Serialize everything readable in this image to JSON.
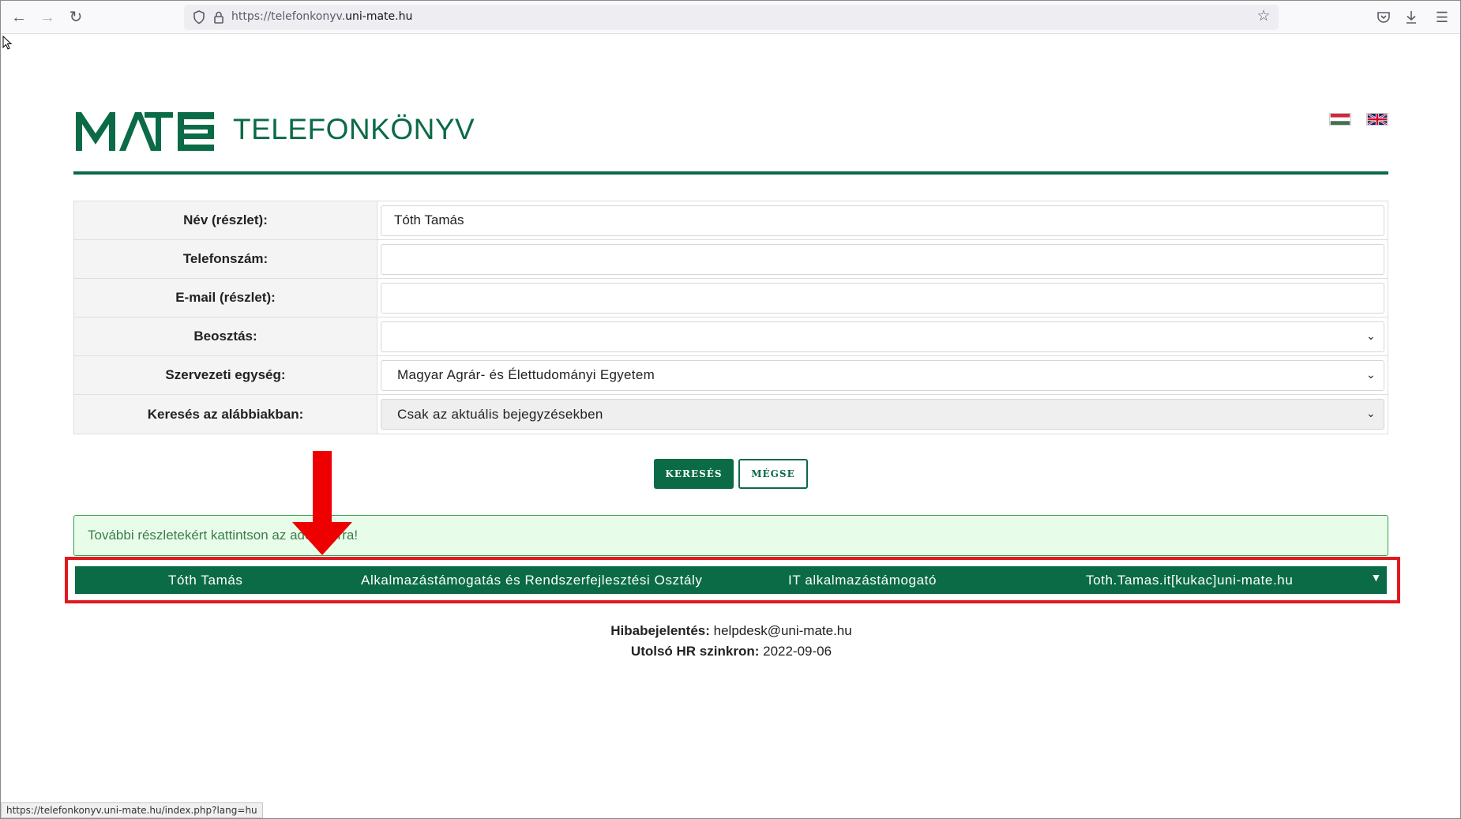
{
  "browser": {
    "url_prefix": "https://telefonkonyv.",
    "url_domain": "uni-mate.hu",
    "status_url": "https://telefonkonyv.uni-mate.hu/index.php?lang=hu"
  },
  "header": {
    "logo_text": "MATE",
    "title": "TELEFONKÖNYV"
  },
  "form": {
    "name_label": "Név (részlet):",
    "name_value": "Tóth Tamás",
    "phone_label": "Telefonszám:",
    "phone_value": "",
    "email_label": "E-mail (részlet):",
    "email_value": "",
    "position_label": "Beosztás:",
    "position_value": "",
    "unit_label": "Szervezeti egység:",
    "unit_value": "Magyar Agrár- és Élettudományi Egyetem",
    "scope_label": "Keresés az alábbiakban:",
    "scope_value": "Csak az aktuális bejegyzésekben"
  },
  "buttons": {
    "search": "KERESÉS",
    "cancel": "MÉGSE"
  },
  "info": {
    "text": "További részletekért kattintson az adott sorra!"
  },
  "result": {
    "name": "Tóth Tamás",
    "department": "Alkalmazástámogatás és Rendszerfejlesztési Osztály",
    "position": "IT alkalmazástámogató",
    "email": "Toth.Tamas.it[kukac]uni-mate.hu"
  },
  "footer": {
    "report_label": "Hibabejelentés:",
    "report_value": "helpdesk@uni-mate.hu",
    "sync_label": "Utolsó HR szinkron:",
    "sync_value": "2022-09-06"
  },
  "colors": {
    "brand_green": "#0a6b46",
    "highlight_red": "#e0191f"
  }
}
